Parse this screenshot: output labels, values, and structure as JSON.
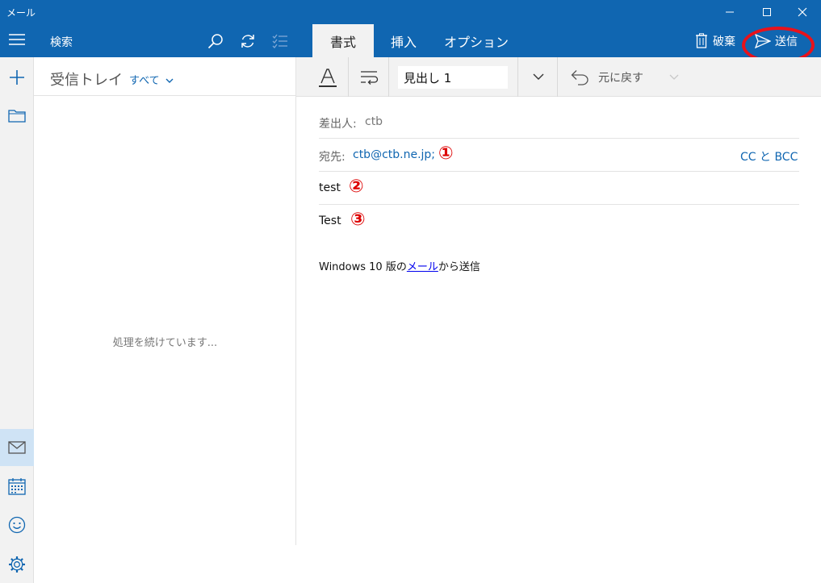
{
  "window": {
    "title": "メール",
    "minimize_icon": "minimize-icon",
    "maximize_icon": "maximize-icon",
    "close_icon": "close-icon"
  },
  "rail": {
    "items": [
      "hamburger-menu-icon",
      "new-mail-icon",
      "folder-icon",
      "mail-icon",
      "calendar-icon",
      "emoji-icon",
      "settings-icon"
    ],
    "active": "mail-icon"
  },
  "list": {
    "search_label": "検索",
    "inbox_title": "受信トレイ",
    "filter_label": "すべて",
    "processing_text": "処理を続けています..."
  },
  "compose": {
    "tabs": [
      "書式",
      "挿入",
      "オプション"
    ],
    "active_tab": "書式",
    "discard_label": "破棄",
    "send_label": "送信",
    "style_value": "見出し 1",
    "undo_label": "元に戻す",
    "from_label": "差出人:",
    "from_value": "ctb",
    "to_label": "宛先:",
    "to_value": "ctb@ctb.ne.jp;",
    "cc_bcc_label": "CC と BCC",
    "subject_value": "test",
    "body_value": "Test",
    "signature_prefix": "Windows 10  版の",
    "signature_link": "メール",
    "signature_suffix": "から送信",
    "annotations": [
      "①",
      "②",
      "③"
    ]
  },
  "colors": {
    "accent": "#1066b1",
    "annotation_red": "#e8121b",
    "link_blue": "#1066b1"
  }
}
